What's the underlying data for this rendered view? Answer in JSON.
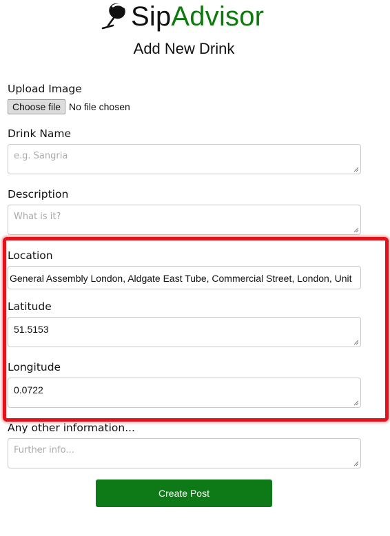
{
  "brand": {
    "name_part1": "Sip",
    "name_part2": "Advisor",
    "accent_color": "#0e7a0d",
    "icon": "wine-glass-icon"
  },
  "page": {
    "title": "Add New Drink"
  },
  "form": {
    "upload": {
      "label": "Upload Image",
      "button_label": "Choose file",
      "status": "No file chosen"
    },
    "drink_name": {
      "label": "Drink Name",
      "placeholder": "e.g. Sangria",
      "value": ""
    },
    "description": {
      "label": "Description",
      "placeholder": "What is it?",
      "value": ""
    },
    "location": {
      "label": "Location",
      "value": "General Assembly London, Aldgate East Tube, Commercial Street, London, Unit"
    },
    "latitude": {
      "label": "Latitude",
      "value": "51.5153"
    },
    "longitude": {
      "label": "Longitude",
      "value": "0.0722"
    },
    "other_info": {
      "label": "Any other information...",
      "placeholder": "Further info...",
      "value": ""
    },
    "submit_label": "Create Post"
  },
  "annotation": {
    "highlight_color": "#e3131b"
  }
}
